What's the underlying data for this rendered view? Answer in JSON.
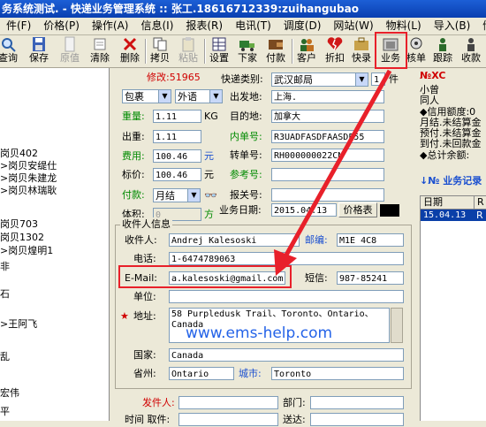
{
  "window": {
    "title": "务系统测试. - 快递业务管理系统 :: 张工.18616712339:zuihangubao"
  },
  "menu": [
    "件(F)",
    "价格(P)",
    "操作(A)",
    "信息(I)",
    "报表(R)",
    "电讯(T)",
    "调度(D)",
    "网站(W)",
    "物料(L)",
    "导入(B)",
    "储运"
  ],
  "toolbar": {
    "query": "查询",
    "save": "保存",
    "original": "原值",
    "clear": "清除",
    "delete": "删除",
    "copy": "拷贝",
    "paste": "粘贴",
    "settings": "设置",
    "order": "下家",
    "pay": "付款",
    "customer": "客户",
    "discount": "折扣",
    "quick": "快录",
    "business": "业务",
    "verify": "核单",
    "track": "跟踪",
    "collect": "收款"
  },
  "tree": [
    "岗贝402",
    "岗贝安缇仕",
    "岗贝朱建龙",
    "岗贝林瑞耿",
    "岗贝703",
    "岗贝1302",
    "岗贝煌明1",
    "非",
    "石",
    "王阿飞",
    "乱",
    "宏伟",
    "平"
  ],
  "form": {
    "modify_no": "修改:51965",
    "pack_type": "包裹",
    "foreign": "外语",
    "express_type_label": "快递类别:",
    "express_type": "武汉邮局",
    "count": "1",
    "count_unit": "件",
    "origin_label": "出发地:",
    "origin": "上海.",
    "dest_label": "目的地:",
    "dest": "加拿大",
    "inner_no_label": "内单号:",
    "inner_no": "R3UADFASDFAASDF55",
    "transfer_no_label": "转单号:",
    "transfer_no": "RH000000022CN",
    "ref_no_label": "参考号:",
    "ref_no": "",
    "customs_no_label": "报关号:",
    "customs_no": "",
    "weight_label": "重量:",
    "weight": "1.11",
    "weight_unit": "KG",
    "out_weight_label": "出重:",
    "out_weight": "1.11",
    "fee_label": "费用:",
    "fee": "100.46",
    "fee_unit": "元",
    "list_price_label": "标价:",
    "list_price": "100.46",
    "list_unit": "元",
    "payment_label": "付款:",
    "payment": "月结",
    "volume_label": "体积:",
    "volume": "0",
    "volume_unit": "方",
    "biz_date_label": "业务日期:",
    "biz_date": "2015.04.13",
    "price_table_button": "价格表",
    "receiver_group": "收件人信息",
    "receiver_label": "收件人:",
    "receiver": "Andrej Kalesoski",
    "postcode_label": "邮编:",
    "postcode": "M1E 4C8",
    "phone_label": "电话:",
    "phone": "1-6474789063",
    "email_label": "E-Mail:",
    "email": "a.kalesoski@gmail.com",
    "sms_label": "短信:",
    "sms": "987-85241",
    "company_label": "单位:",
    "company": "",
    "address_label": "地址:",
    "address_line1": "58 Purpledusk Trail、Toronto、Ontario、",
    "address_line2": "Canada",
    "country_label": "国家:",
    "country": "Canada",
    "province_label": "省州:",
    "province": "Ontario",
    "city_label": "城市:",
    "city": "Toronto",
    "sender_label": "发件人:",
    "dept_label": "部门:",
    "pickup_label": "时间 取件:",
    "delivery_label": "送达:"
  },
  "right": {
    "code": "№XC",
    "lines": [
      "小曾",
      "同人",
      "◆信用额度:0",
      "月结.未结算金",
      "预付.未结算金",
      "到付.未回款金",
      "◆总计余额:"
    ],
    "records_title": "业务记录",
    "col_date": "日期",
    "col_r": "R",
    "row_date": "15.04.13",
    "row_r": "R"
  },
  "watermark": "www.ems-help.com",
  "colors": {
    "highlight": "#e8202a",
    "title_bar": "#0a3fb0",
    "label_blue": "#1a4fd0",
    "label_red": "#d00000",
    "selection": "#0a3fa8"
  }
}
